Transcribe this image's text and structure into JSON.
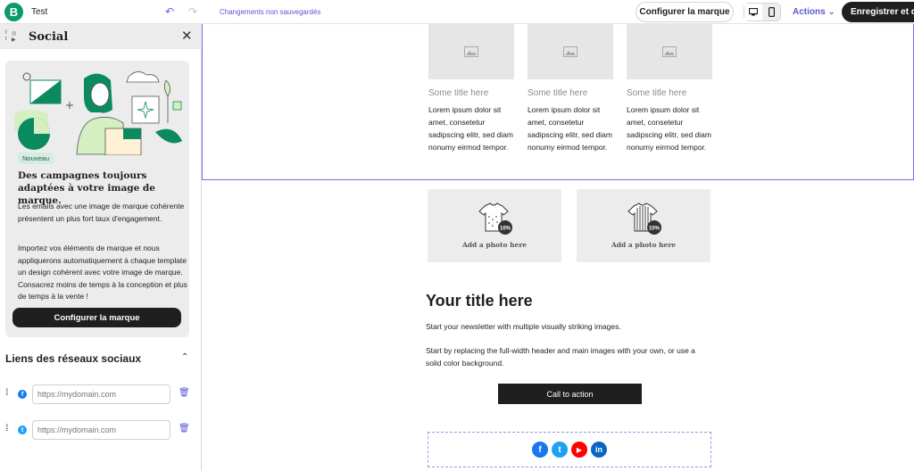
{
  "topbar": {
    "logo_letter": "B",
    "campaign_name": "Test",
    "undo_icon": "undo-arrow-icon",
    "redo_icon": "redo-arrow-icon",
    "unsaved_status": "Changements non sauvegardés",
    "configure_brand_label": "Configurer la marque",
    "actions_label": "Actions",
    "save_label": "Enregistrer et qu"
  },
  "sidebar": {
    "title": "Social",
    "promo": {
      "badge": "Nouveau",
      "title": "Des campagnes toujours adaptées à votre image de marque.",
      "paragraph1": "Les emails avec une image de marque cohérente présentent un plus fort taux d'engagement.",
      "paragraph2": "Importez vos éléments de marque et nous appliquerons automatiquement à chaque template un design cohérent avec votre image de marque. Consacrez moins de temps à la conception et plus de temps à la vente !",
      "button_label": "Configurer la marque"
    },
    "links_section": {
      "title": "Liens des réseaux sociaux",
      "rows": [
        {
          "network": "facebook",
          "value": "",
          "placeholder": "https://mydomain.com",
          "color": "#1877f2"
        },
        {
          "network": "twitter",
          "value": "",
          "placeholder": "https://mydomain.com",
          "color": "#1da1f2"
        }
      ]
    }
  },
  "canvas": {
    "columns": [
      {
        "title": "Some title here",
        "text": "Lorem ipsum dolor sit amet, consetetur sadipscing elitr, sed diam nonumy eirmod tempor."
      },
      {
        "title": "Some title here",
        "text": "Lorem ipsum dolor sit amet, consetetur sadipscing elitr, sed diam nonumy eirmod tempor."
      },
      {
        "title": "Some title here",
        "text": "Lorem ipsum dolor sit amet, consetetur sadipscing elitr, sed diam nonumy eirmod tempor."
      }
    ],
    "photos": [
      {
        "label": "Add a photo here",
        "discount": "10%"
      },
      {
        "label": "Add a photo here",
        "discount": "10%"
      }
    ],
    "newsletter": {
      "title": "Your title here",
      "paragraph1": "Start your newsletter with multiple visually striking images.",
      "paragraph2": "Start by replacing the full-width header and main images with your own, or use a solid color background.",
      "cta_label": "Call to action"
    },
    "social_icons": [
      {
        "name": "facebook",
        "glyph": "f",
        "color": "#1877f2"
      },
      {
        "name": "twitter",
        "glyph": "t",
        "color": "#1da1f2"
      },
      {
        "name": "youtube",
        "glyph": "▶",
        "color": "#ff0000"
      },
      {
        "name": "linkedin",
        "glyph": "in",
        "color": "#0a66c2"
      }
    ]
  }
}
